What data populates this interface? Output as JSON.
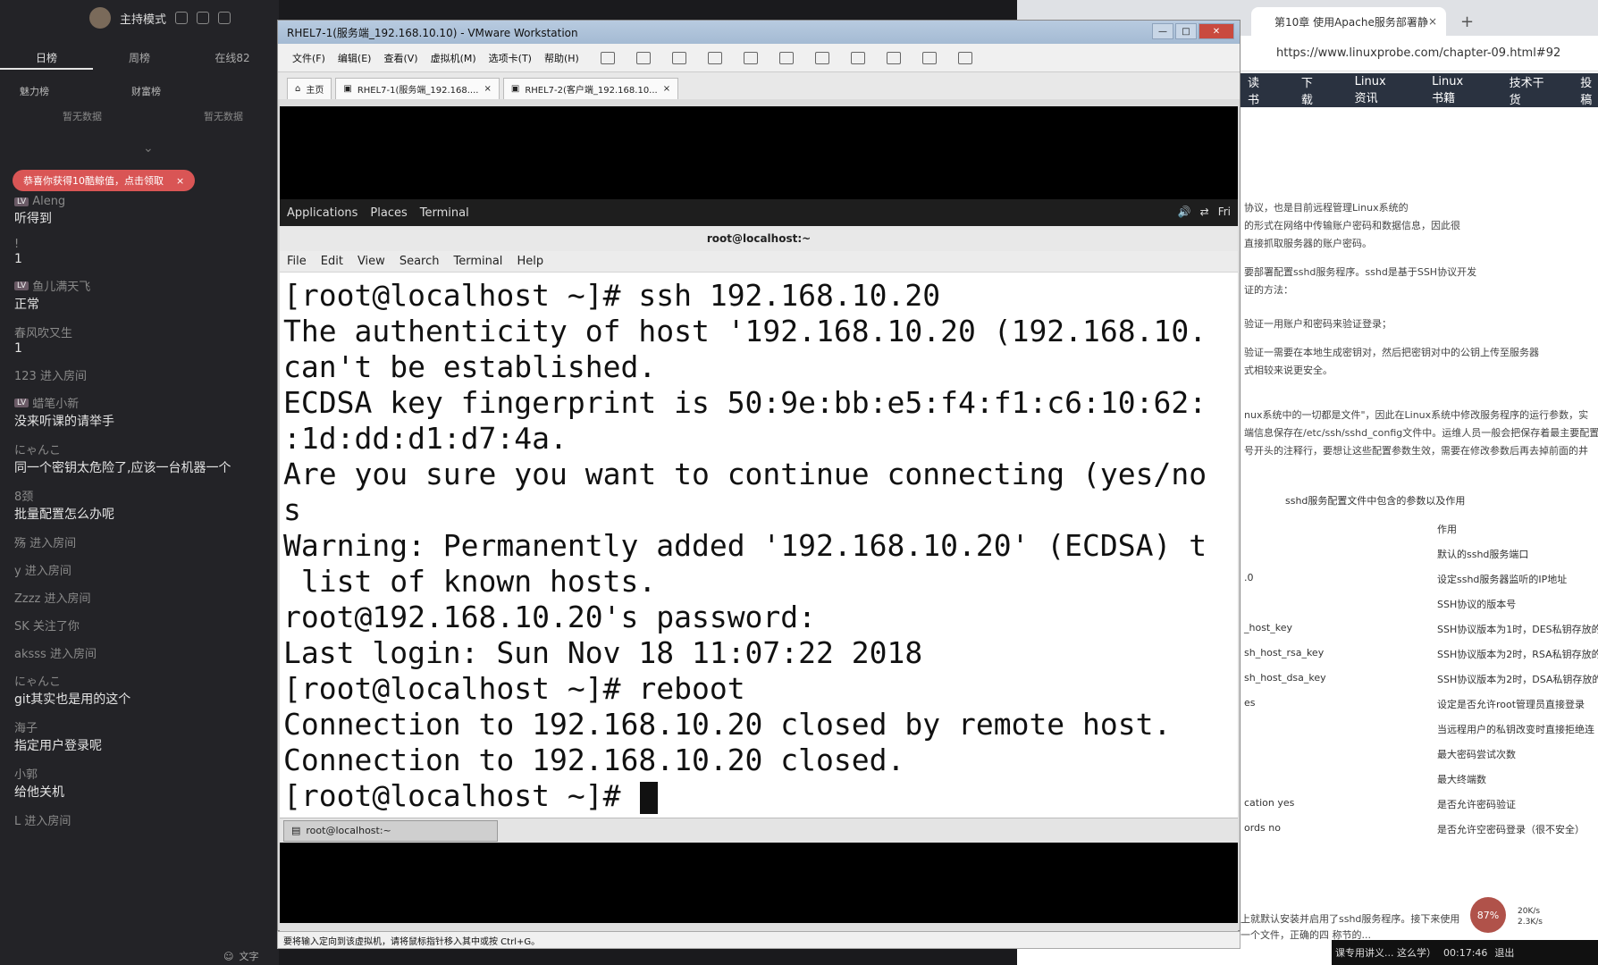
{
  "left_panel": {
    "mode_label": "主持模式",
    "tabs": [
      "日榜",
      "周榜",
      "在线82"
    ],
    "leaderboards": [
      {
        "name": "魅力榜",
        "empty": "暂无数据"
      },
      {
        "name": "财富榜",
        "empty": "暂无数据"
      }
    ],
    "notice": "恭喜你获得10酷鲸值，点击领取",
    "notice_close": "×",
    "chat": [
      {
        "name": "Aleng",
        "text": "听得到",
        "level": "LV"
      },
      {
        "name": "!",
        "text": "1"
      },
      {
        "name": "鱼儿满天飞",
        "text": "正常",
        "level": "LV"
      },
      {
        "name": "春风吹又生",
        "text": "1"
      },
      {
        "name": "123 进入房间",
        "text": ""
      },
      {
        "name": "蜡笔小新",
        "text": "没来听课的请举手",
        "level": "LV"
      },
      {
        "name": "にゃんこ",
        "text": "同一个密钥太危险了,应该一台机器一个"
      },
      {
        "name": "8颈",
        "text": "批量配置怎么办呢"
      },
      {
        "name": "殇 进入房间",
        "text": ""
      },
      {
        "name": "y 进入房间",
        "text": ""
      },
      {
        "name": "Zzzz 进入房间",
        "text": ""
      },
      {
        "name": "SK 关注了你",
        "text": ""
      },
      {
        "name": "aksss 进入房间",
        "text": ""
      },
      {
        "name": "にゃんこ",
        "text": "git其实也是用的这个"
      },
      {
        "name": "海子",
        "text": "指定用户登录呢"
      },
      {
        "name": "小郭",
        "text": "给他关机"
      },
      {
        "name": "L 进入房间",
        "text": ""
      }
    ],
    "bottom_label": "文字"
  },
  "vmware": {
    "title": "RHEL7-1(服务端_192.168.10.10) - VMware Workstation",
    "menu": [
      "文件(F)",
      "编辑(E)",
      "查看(V)",
      "虚拟机(M)",
      "选项卡(T)",
      "帮助(H)"
    ],
    "tabs": [
      "主页",
      "RHEL7-1(服务端_192.168....",
      "RHEL7-2(客户端_192.168.10..."
    ],
    "status_text": "要将输入定向到该虚拟机，请将鼠标指针移入其中或按 Ctrl+G。",
    "gnome": {
      "applications": "Applications",
      "places": "Places",
      "terminal": "Terminal",
      "clock": "Fri"
    },
    "terminal": {
      "title": "root@localhost:~",
      "menu": [
        "File",
        "Edit",
        "View",
        "Search",
        "Terminal",
        "Help"
      ],
      "lines": [
        "[root@localhost ~]# ssh 192.168.10.20",
        "The authenticity of host '192.168.10.20 (192.168.10.",
        "can't be established.",
        "ECDSA key fingerprint is 50:9e:bb:e5:f4:f1:c6:10:62:",
        ":1d:dd:d1:d7:4a.",
        "Are you sure you want to continue connecting (yes/no",
        "s",
        "Warning: Permanently added '192.168.10.20' (ECDSA) t",
        " list of known hosts.",
        "root@192.168.10.20's password:",
        "Last login: Sun Nov 18 11:07:22 2018",
        "[root@localhost ~]# reboot",
        "Connection to 192.168.10.20 closed by remote host.",
        "Connection to 192.168.10.20 closed.",
        "[root@localhost ~]# "
      ]
    },
    "taskbar_item": "root@localhost:~"
  },
  "browser": {
    "tab_title": "第10章 使用Apache服务部署静",
    "tab_close": "×",
    "new_tab": "+",
    "url": "https://www.linuxprobe.com/chapter-09.html#92",
    "nav": [
      "读书",
      "下载",
      "Linux资讯",
      "Linux书籍",
      "技术干货",
      "投稿"
    ],
    "body_lines": [
      "协议，也是目前远程管理Linux系统的",
      "的形式在网络中传输账户密码和数据信息，因此很",
      "直接抓取服务器的账户密码。",
      "要部署配置sshd服务程序。sshd是基于SSH协议开发",
      "证的方法：",
      "验证一用账户和密码来验证登录；",
      "验证一需要在本地生成密钥对，然后把密钥对中的公钥上传至服务器",
      "式相较来说更安全。",
      "nux系统中的一切都是文件\"，因此在Linux系统中修改服务程序的运行参数，实",
      "端信息保存在/etc/ssh/sshd_config文件中。运维人员一般会把保存着最主要配置",
      "号开头的注释行，要想让这些配置参数生效，需要在修改参数后再去掉前面的井"
    ],
    "table_caption": "sshd服务配置文件中包含的参数以及作用",
    "table_header": "作用",
    "table_rows": [
      {
        "param": "",
        "desc": "默认的sshd服务端口"
      },
      {
        "param": ".0",
        "desc": "设定sshd服务器监听的IP地址"
      },
      {
        "param": "",
        "desc": "SSH协议的版本号"
      },
      {
        "param": "_host_key",
        "desc": "SSH协议版本为1时，DES私钥存放的"
      },
      {
        "param": "sh_host_rsa_key",
        "desc": "SSH协议版本为2时，RSA私钥存放的"
      },
      {
        "param": "sh_host_dsa_key",
        "desc": "SSH协议版本为2时，DSA私钥存放的"
      },
      {
        "param": "es",
        "desc": "设定是否允许root管理员直接登录"
      },
      {
        "param": "",
        "desc": "当远程用户的私钥改变时直接拒绝连"
      },
      {
        "param": "",
        "desc": "最大密码尝试次数"
      },
      {
        "param": "",
        "desc": "最大终端数"
      },
      {
        "param": "cation yes",
        "desc": "是否允许密码验证"
      },
      {
        "param": "ords no",
        "desc": "是否允许空密码登录（很不安全）"
      }
    ],
    "bottom_text": "上就默认安装并启用了sshd服务程序。接下来使用",
    "bottom_text2": "一个文件，正确的四   称节的...",
    "float_badge": "87%",
    "speed_up": "20K/s",
    "speed_down": "2.3K/s",
    "footer_text": "课专用讲义... 这么学）",
    "footer_time": "00:17:46",
    "footer_exit": "退出"
  }
}
